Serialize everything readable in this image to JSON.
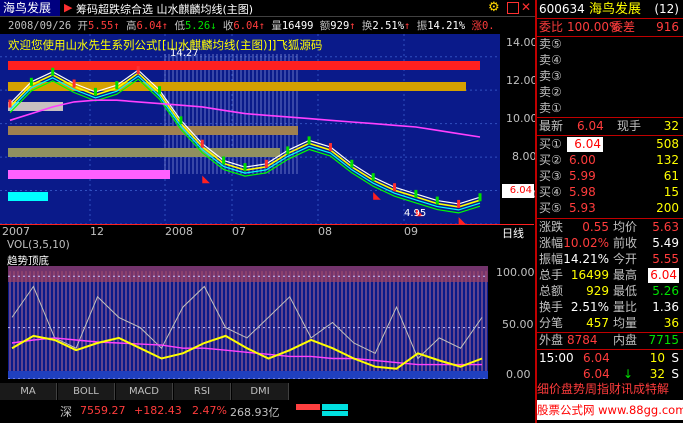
{
  "topbar": {
    "tag": "海鸟发展",
    "title": "筹码超跌综合选 山水麒麟均线(主图)"
  },
  "quote": {
    "date": "2008/09/26",
    "open_label": "开",
    "open": "5.55",
    "high_label": "高",
    "high": "6.04",
    "low_label": "低",
    "low": "5.26",
    "close_label": "收",
    "close": "6.04",
    "vol_label": "量",
    "vol": "16499",
    "amt_label": "额",
    "amt": "929",
    "turn_label": "换",
    "turn": "2.51%",
    "amp_label": "振",
    "amp": "14.21%",
    "chg_label": "涨",
    "chg": "0."
  },
  "banner": "欢迎您使用山水先生系列公式[[山水麒麟均线(主图)]]飞狐源码",
  "chart_data": [
    {
      "type": "line",
      "title": "山水麒麟均线(主图)",
      "x": [
        "2007",
        "12",
        "2008",
        "07",
        "08",
        "09"
      ],
      "ylim": [
        4,
        15
      ],
      "yticks": [
        4.0,
        6.0,
        8.0,
        10.0,
        12.0,
        14.0
      ],
      "annotations": [
        "14.27",
        "4.95",
        "6.04"
      ],
      "series": [
        {
          "values": [
            11.2,
            12.5,
            13.1,
            12.4,
            11.9,
            12.3,
            13.2,
            12.0,
            10.2,
            8.8,
            7.8,
            7.4,
            7.6,
            8.4,
            9.0,
            8.6,
            7.6,
            6.8,
            6.2,
            5.8,
            5.4,
            5.2,
            5.6
          ]
        }
      ]
    },
    {
      "type": "line",
      "title": "趋势顶底",
      "ylim": [
        0,
        110
      ],
      "yticks": [
        0,
        50,
        100
      ],
      "series": [
        {
          "values": [
            30,
            42,
            38,
            28,
            35,
            40,
            30,
            20,
            25,
            35,
            42,
            30,
            20,
            28,
            38,
            30,
            20,
            12,
            10,
            25,
            18,
            12,
            20
          ]
        }
      ]
    }
  ],
  "price_axis": [
    "14.00",
    "12.00",
    "10.00",
    "8.00",
    "6.00",
    "4.00"
  ],
  "price_tag": "6.04",
  "date_axis": [
    "2007",
    "12",
    "2008",
    "07",
    "08",
    "09",
    "日线"
  ],
  "vol_label": "VOL(3,5,10)",
  "sub_title": "趋势顶底",
  "sub_axis": [
    "100.00",
    "50.00",
    "0.00"
  ],
  "tabs": [
    "MA",
    "BOLL",
    "MACD",
    "RSI",
    "DMI"
  ],
  "status": {
    "index": "深",
    "value": "7559.27",
    "change": "+182.43",
    "pct": "2.47%",
    "amount": "268.93亿"
  },
  "rp": {
    "code": "600634",
    "name": "海鸟发展",
    "count": "(12)",
    "wb_label": "委比",
    "wb": "100.00%",
    "wc_label": "委差",
    "wc": "916",
    "sells": [
      "卖⑤",
      "卖④",
      "卖③",
      "卖②",
      "卖①"
    ],
    "latest_label": "最新",
    "latest": "6.04",
    "now_label": "现手",
    "now": "32",
    "buys": [
      {
        "label": "买①",
        "price": "6.04",
        "vol": "508"
      },
      {
        "label": "买②",
        "price": "6.00",
        "vol": "132"
      },
      {
        "label": "买③",
        "price": "5.99",
        "vol": "61"
      },
      {
        "label": "买④",
        "price": "5.98",
        "vol": "15"
      },
      {
        "label": "买⑤",
        "price": "5.93",
        "vol": "200"
      }
    ],
    "stats": [
      {
        "l1": "涨跌",
        "v1": "0.55",
        "l2": "均价",
        "v2": "5.63"
      },
      {
        "l1": "涨幅",
        "v1": "10.02%",
        "l2": "前收",
        "v2": "5.49"
      },
      {
        "l1": "振幅",
        "v1": "14.21%",
        "l2": "今开",
        "v2": "5.55"
      },
      {
        "l1": "总手",
        "v1": "16499",
        "l2": "最高",
        "v2": "6.04"
      },
      {
        "l1": "总额",
        "v1": "929",
        "l2": "最低",
        "v2": "5.26"
      },
      {
        "l1": "换手",
        "v1": "2.51%",
        "l2": "量比",
        "v2": "1.36"
      },
      {
        "l1": "分笔",
        "v1": "457",
        "l2": "均量",
        "v2": "36"
      }
    ],
    "outer_label": "外盘",
    "outer": "8784",
    "inner_label": "内盘",
    "inner": "7715",
    "ticks": [
      {
        "time": "15:00",
        "price": "6.04",
        "vol": "10",
        "flag": "S"
      },
      {
        "time": "",
        "price": "6.04",
        "vol": "32",
        "flag": "S"
      }
    ],
    "menu": "细价盘势周指财讯成特解",
    "site": "股票公式网 www.88gg.com"
  }
}
